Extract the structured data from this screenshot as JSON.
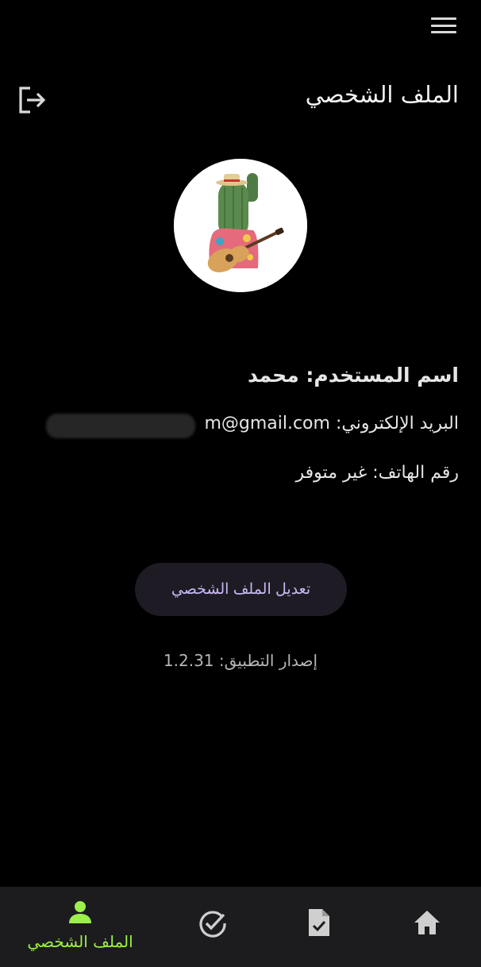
{
  "header": {
    "title": "الملف الشخصي",
    "menu_icon": "hamburger-menu-icon",
    "logout_icon": "logout-icon"
  },
  "profile": {
    "avatar_icon": "cactus-guitar-avatar",
    "username_line": "اسم المستخدم: محمد",
    "email_line": "البريد الإلكتروني: m@gmail.com",
    "phone_line": "رقم الهاتف: غير متوفر"
  },
  "actions": {
    "edit_label": "تعديل الملف الشخصي"
  },
  "footer": {
    "version_line": "إصدار التطبيق: 1.2.31"
  },
  "nav": {
    "items": [
      {
        "label": "الملف الشخصي",
        "icon": "person-icon",
        "active": true
      },
      {
        "label": "",
        "icon": "check-circle-icon",
        "active": false
      },
      {
        "label": "",
        "icon": "document-check-icon",
        "active": false
      },
      {
        "label": "",
        "icon": "home-icon",
        "active": false
      }
    ]
  },
  "colors": {
    "background": "#000000",
    "nav_background": "#1c1c1f",
    "active_accent": "#9cf04a",
    "button_background": "#1e1b24",
    "button_text": "#c9b8f2"
  }
}
